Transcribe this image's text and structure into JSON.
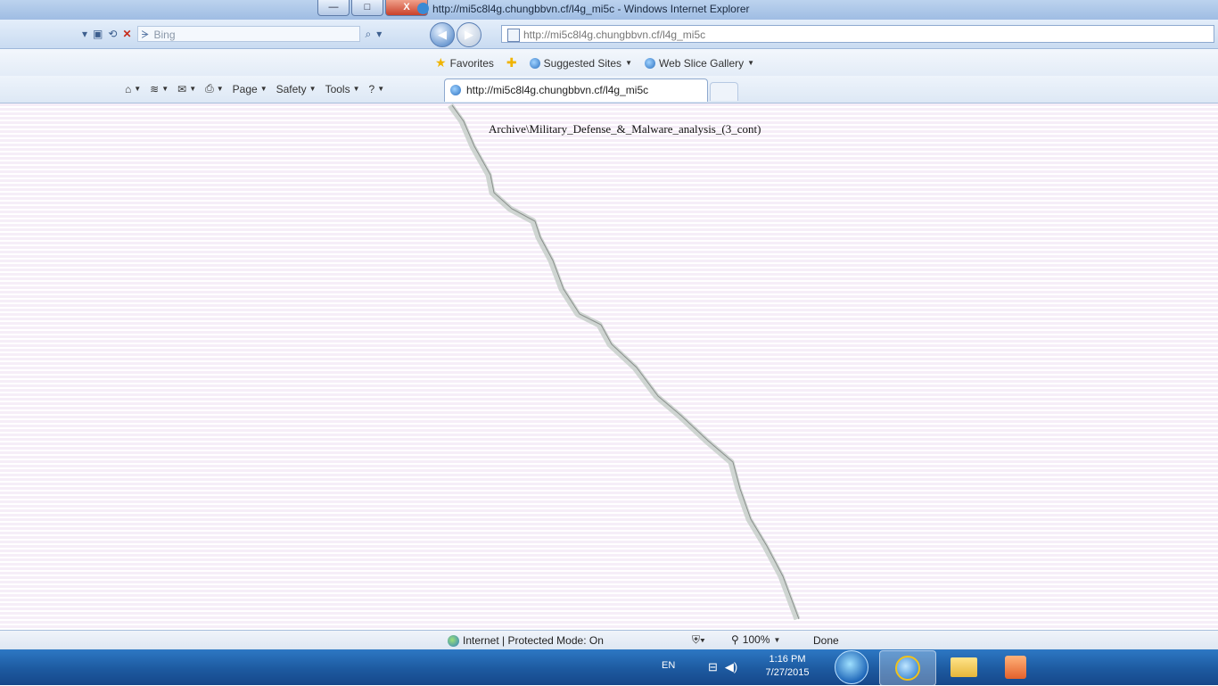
{
  "window": {
    "title": "http://mi5c8l4g.chungbbvn.cf/l4g_mi5c - Windows Internet Explorer",
    "buttons": {
      "minimize": "—",
      "maximize": "□",
      "close": "X"
    }
  },
  "address_bar": {
    "url": "http://mi5c8l4g.chungbbvn.cf/l4g_mi5c",
    "search_placeholder": "Bing"
  },
  "favorites_bar": {
    "favorites_label": "Favorites",
    "items": [
      {
        "label": "Suggested Sites"
      },
      {
        "label": "Web Slice Gallery"
      }
    ]
  },
  "command_bar": {
    "page_label": "Page",
    "safety_label": "Safety",
    "tools_label": "Tools"
  },
  "tab": {
    "title": "http://mi5c8l4g.chungbbvn.cf/l4g_mi5c"
  },
  "content": {
    "text": "Archive\\Military_Defense_&_Malware_analysis_(3_cont)"
  },
  "status_bar": {
    "zone": "Internet | Protected Mode: On",
    "zoom": "100%",
    "status": "Done"
  },
  "taskbar": {
    "language": "EN",
    "clock_time": "1:16 PM",
    "clock_date": "7/27/2015"
  }
}
